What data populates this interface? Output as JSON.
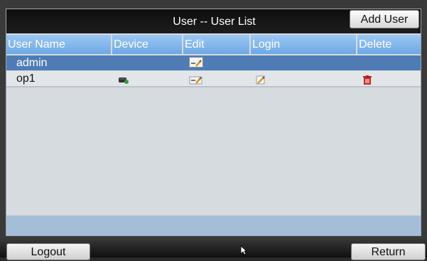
{
  "window": {
    "title": "User -- User List",
    "add_user_label": "Add User"
  },
  "table": {
    "columns": [
      "User Name",
      "Device",
      "Edit",
      "Login",
      "Delete"
    ],
    "rows": [
      {
        "user_name": "admin",
        "selected": true
      },
      {
        "user_name": "op1",
        "selected": false
      }
    ]
  },
  "footer": {
    "logout_label": "Logout",
    "return_label": "Return"
  },
  "icons": {
    "device": "device-icon",
    "edit": "edit-icon",
    "login": "login-pencil-icon",
    "delete": "delete-trash-icon",
    "cursor": "mouse-pointer-icon"
  },
  "colors": {
    "header_blue": "#7fb3ea",
    "selected_row": "#4f7cb5",
    "delete_red": "#c8281e",
    "title_bar": "#141414"
  }
}
